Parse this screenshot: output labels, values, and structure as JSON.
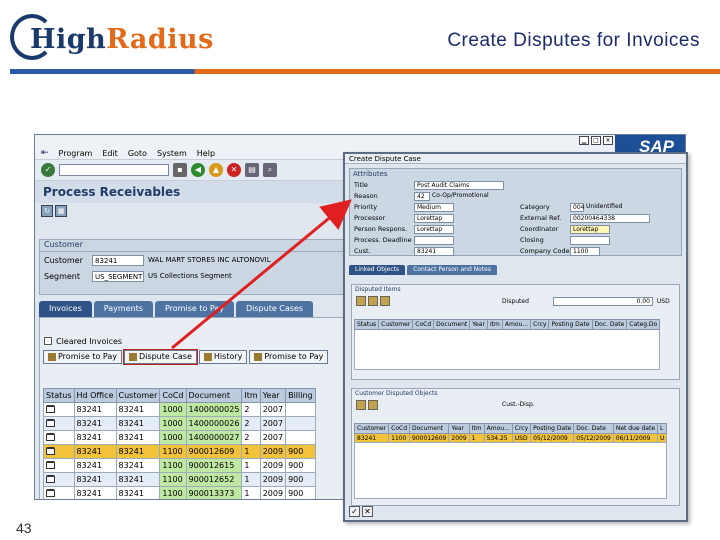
{
  "slide": {
    "logo_part1": "High",
    "logo_part2": "Radius",
    "title": "Create Disputes for Invoices",
    "page_number": "43"
  },
  "colors": {
    "navy": "#1a3a6b",
    "orange": "#e36a1a",
    "sap_blue": "#1c4f95",
    "selected_row": "#f2c23a",
    "arrow": "#e02020"
  },
  "sap": {
    "brand": "SAP",
    "menu": [
      "Program",
      "Edit",
      "Goto",
      "System",
      "Help"
    ],
    "page_title": "Process Receivables",
    "customer_panel": {
      "title": "Customer",
      "customer_label": "Customer",
      "customer_value": "83241",
      "customer_name": "WAL MART STORES INC ALTONOVIL",
      "segment_label": "Segment",
      "segment_value": "US_SEGMENT",
      "segment_name": "US Collections Segment"
    },
    "tabs": [
      "Invoices",
      "Payments",
      "Promise to Pay",
      "Dispute Cases"
    ],
    "cleared_invoices_label": "Cleared Invoices",
    "buttons": {
      "promise_to_pay": "Promise to Pay",
      "dispute_case": "Dispute Case",
      "history": "History",
      "promise_to_pay_2": "Promise to Pay"
    },
    "grid": {
      "headers": [
        "Status",
        "Hd Office",
        "Customer",
        "CoCd",
        "Document",
        "Itm",
        "Year",
        "Billing"
      ],
      "rows": [
        [
          "",
          "83241",
          "83241",
          "1000",
          "1400000025",
          "2",
          "2007",
          ""
        ],
        [
          "",
          "83241",
          "83241",
          "1000",
          "1400000026",
          "2",
          "2007",
          ""
        ],
        [
          "",
          "83241",
          "83241",
          "1000",
          "1400000027",
          "2",
          "2007",
          ""
        ],
        [
          "",
          "83241",
          "83241",
          "1100",
          "900012609",
          "1",
          "2009",
          "900"
        ],
        [
          "",
          "83241",
          "83241",
          "1100",
          "900012615",
          "1",
          "2009",
          "900"
        ],
        [
          "",
          "83241",
          "83241",
          "1100",
          "900012652",
          "1",
          "2009",
          "900"
        ],
        [
          "",
          "83241",
          "83241",
          "1100",
          "900013373",
          "1",
          "2009",
          "900"
        ]
      ]
    }
  },
  "dialog": {
    "title": "Create Dispute Case",
    "attributes_title": "Attributes",
    "fields": {
      "title_label": "Title",
      "title_value": "Post Audit Claims",
      "reason_label": "Reason",
      "reason_code": "42",
      "reason_desc": "Co-Op/Promotional",
      "priority_label": "Priority",
      "priority_value": "Medium",
      "processor_label": "Processor",
      "processor_value": "Lorettap",
      "person_resp_label": "Person Respons.",
      "person_resp_value": "Lorettap",
      "deadline_label": "Process. Deadline",
      "cust_label": "Cust.",
      "cust_value": "83241",
      "category_label": "Category",
      "category_code": "004",
      "category_desc": "Unidentified",
      "external_ref_label": "External Ref.",
      "external_ref_value": "00200464338",
      "coordinator_label": "Coordinator",
      "coordinator_value": "Lorettap",
      "closing_label": "Closing",
      "company_code_label": "Company Code",
      "company_code_value": "1100"
    },
    "tabs": [
      "Linked Objects",
      "Contact Person and Notes"
    ],
    "disputed_items": {
      "title": "Disputed Items",
      "disputed_label": "Disputed",
      "disputed_value": "0.00",
      "currency": "USD",
      "headers": [
        "Status",
        "Customer",
        "CoCd",
        "Document",
        "Year",
        "Itm",
        "Amou...",
        "Crcy",
        "Posting Date",
        "Doc. Date",
        "Categ.Do"
      ]
    },
    "customer_disputed": {
      "title": "Customer Disputed Objects",
      "cust_disp_label": "Cust.-Disp.",
      "headers": [
        "Customer",
        "CoCd",
        "Document",
        "Year",
        "Itm",
        "Amou...",
        "Crcy",
        "Posting Date",
        "Doc. Date",
        "Net due date",
        "L"
      ],
      "rows": [
        [
          "83241",
          "1100",
          "900012609",
          "2009",
          "1",
          "534.25",
          "USD",
          "05/12/2009",
          "05/12/2009",
          "06/11/2009",
          "U"
        ]
      ]
    }
  }
}
